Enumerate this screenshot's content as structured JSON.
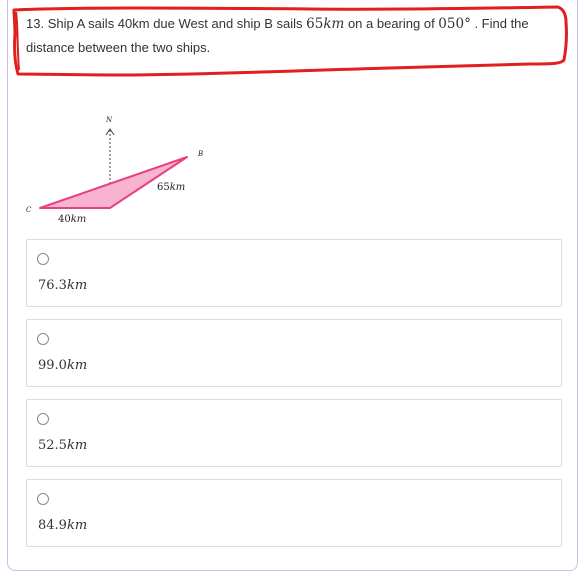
{
  "question": {
    "number": "13.",
    "text_before": "Ship A sails 40km due West and ship B sails ",
    "math_distance": "65",
    "math_unit": "km",
    "text_middle": " on a bearing of ",
    "math_bearing": "050°",
    "text_after": " . Find the distance between the two ships."
  },
  "figure": {
    "north_label": "N",
    "point_b": "B",
    "point_c": "C",
    "side_b_num": "65",
    "side_b_unit": "km",
    "side_c_num": "40",
    "side_c_unit": "km"
  },
  "options": [
    {
      "value": "76.3",
      "unit": "km"
    },
    {
      "value": "99.0",
      "unit": "km"
    },
    {
      "value": "52.5",
      "unit": "km"
    },
    {
      "value": "84.9",
      "unit": "km"
    }
  ],
  "colors": {
    "annotation_red": "#e0201f",
    "triangle_fill": "#f7b3cf",
    "triangle_stroke": "#e9417f",
    "card_border": "#c9c1e6"
  }
}
